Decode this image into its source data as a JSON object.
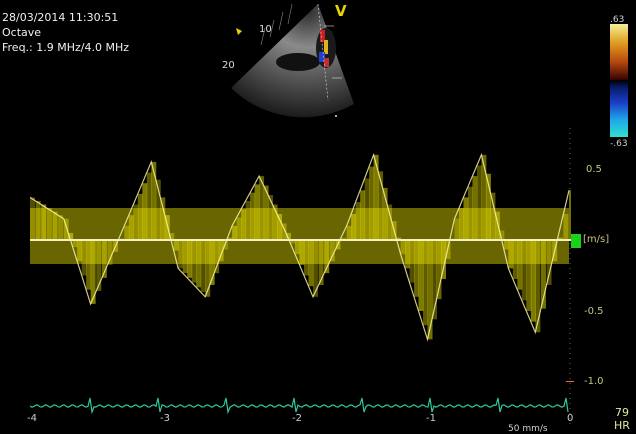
{
  "header": {
    "datetime": "28/03/2014 11:30:51",
    "mode": "Octave",
    "frequency": "Freq.: 1.9 MHz/4.0 MHz"
  },
  "sector_view": {
    "marker": "V",
    "depth_labels": [
      "10",
      "20"
    ]
  },
  "color_bar": {
    "top_value": ".63",
    "bottom_value": "-.63"
  },
  "doppler": {
    "velocity_labels": [
      "0.5",
      "-0.5",
      "-1.0"
    ],
    "unit": "[m/s]",
    "time_labels": [
      "-4",
      "-3",
      "-2",
      "-1",
      "0"
    ],
    "sweep_speed": "50 mm/s",
    "trace_color": "#e8e000",
    "ecg_color": "#30c8a0"
  },
  "heart_rate": {
    "value": "79",
    "label": "HR"
  },
  "chart_data": {
    "type": "line",
    "title": "",
    "xlabel": "",
    "ylabel": "[m/s]",
    "xlim": [
      -4,
      0
    ],
    "ylim": [
      -1.0,
      0.6
    ],
    "x_ticks": [
      -4,
      -3,
      -2,
      -1,
      0
    ],
    "y_ticks": [
      0.5,
      -0.5,
      -1.0
    ],
    "series": [
      {
        "x": [
          -4.0,
          -3.75,
          -3.55,
          -3.3,
          -3.1,
          -2.9,
          -2.7,
          -2.5,
          -2.3,
          -2.1,
          -1.9,
          -1.65,
          -1.45,
          -1.25,
          -1.05,
          -0.85,
          -0.65,
          -0.45,
          -0.25,
          0.0
        ],
        "values": [
          0.3,
          0.15,
          -0.45,
          0.1,
          0.55,
          -0.2,
          -0.4,
          0.1,
          0.45,
          0.05,
          -0.4,
          0.1,
          0.6,
          -0.1,
          -0.7,
          0.15,
          0.6,
          -0.2,
          -0.65,
          0.35
        ]
      }
    ]
  }
}
